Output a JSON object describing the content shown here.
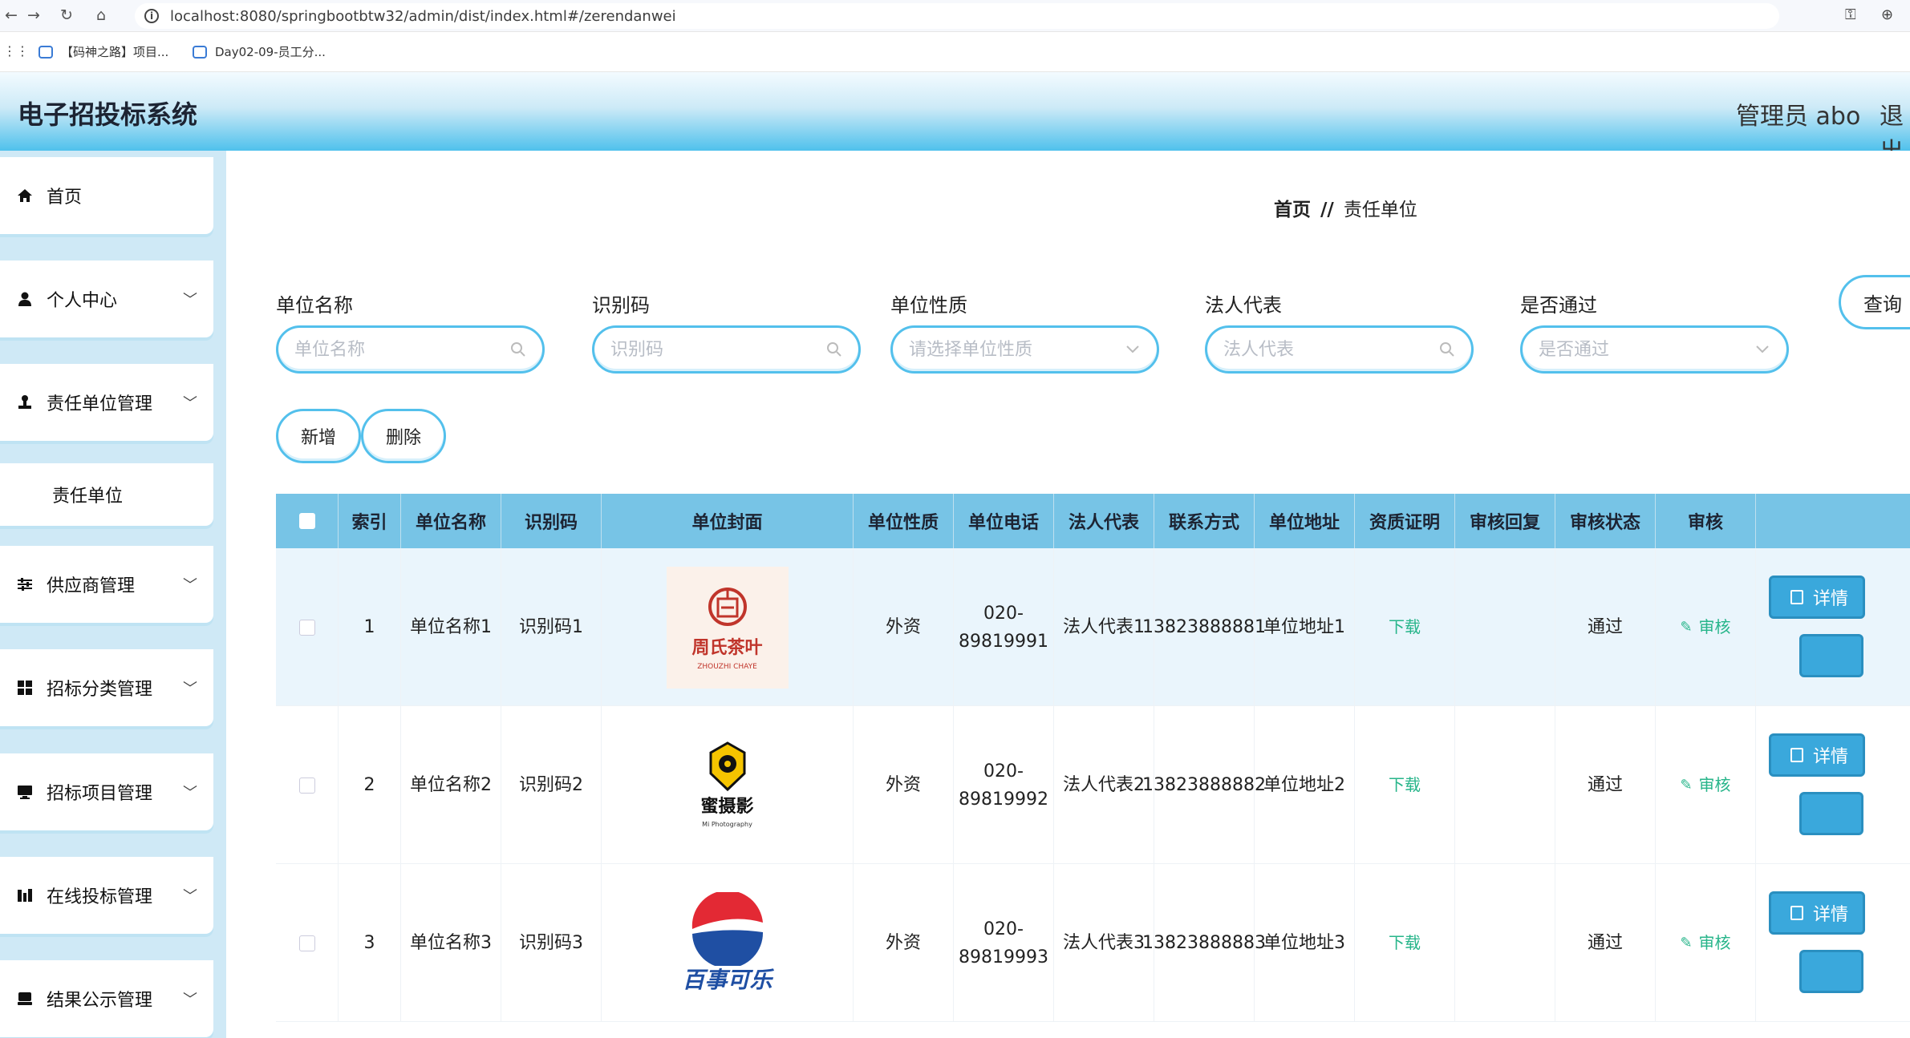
{
  "browser": {
    "url": "localhost:8080/springbootbtw32/admin/dist/index.html#/zerendanwei",
    "bookmarks": [
      "【码神之路】项目...",
      "Day02-09-员工分..."
    ]
  },
  "header": {
    "title": "电子招投标系统",
    "user": "管理员 abo",
    "logout": "退出"
  },
  "sidebar": {
    "items": [
      {
        "label": "首页",
        "icon": "home-icon"
      },
      {
        "label": "个人中心",
        "icon": "user-icon"
      },
      {
        "label": "责任单位管理",
        "icon": "stamp-icon"
      },
      {
        "label": "责任单位",
        "icon": ""
      },
      {
        "label": "供应商管理",
        "icon": "sliders-icon"
      },
      {
        "label": "招标分类管理",
        "icon": "grid-icon"
      },
      {
        "label": "招标项目管理",
        "icon": "monitor-icon"
      },
      {
        "label": "在线投标管理",
        "icon": "chart-icon"
      },
      {
        "label": "结果公示管理",
        "icon": "display-icon"
      }
    ]
  },
  "breadcrumb": {
    "home": "首页",
    "sep": "//",
    "current": "责任单位"
  },
  "search": {
    "fields": [
      {
        "label": "单位名称",
        "placeholder": "单位名称"
      },
      {
        "label": "识别码",
        "placeholder": "识别码"
      },
      {
        "label": "单位性质",
        "placeholder": "请选择单位性质"
      },
      {
        "label": "法人代表",
        "placeholder": "法人代表"
      },
      {
        "label": "是否通过",
        "placeholder": "是否通过"
      }
    ],
    "query": "查询"
  },
  "actions": {
    "add": "新增",
    "delete": "删除"
  },
  "table": {
    "headers": [
      "索引",
      "单位名称",
      "识别码",
      "单位封面",
      "单位性质",
      "单位电话",
      "法人代表",
      "联系方式",
      "单位地址",
      "资质证明",
      "审核回复",
      "审核状态",
      "审核"
    ],
    "rows": [
      {
        "index": "1",
        "name": "单位名称1",
        "code": "识别码1",
        "cover_brand": "周氏茶叶",
        "cover_sub": "ZHOUZHI CHAYE",
        "nature": "外资",
        "phone": "020-89819991",
        "legal": "法人代表1",
        "contact": "13823888881",
        "address": "单位地址1",
        "cert": "下载",
        "reply": "",
        "status": "通过",
        "audit": "审核",
        "detail": "详情"
      },
      {
        "index": "2",
        "name": "单位名称2",
        "code": "识别码2",
        "cover_brand": "蜜摄影",
        "cover_sub": "Mi Photography",
        "nature": "外资",
        "phone": "020-89819992",
        "legal": "法人代表2",
        "contact": "13823888882",
        "address": "单位地址2",
        "cert": "下载",
        "reply": "",
        "status": "通过",
        "audit": "审核",
        "detail": "详情"
      },
      {
        "index": "3",
        "name": "单位名称3",
        "code": "识别码3",
        "cover_brand": "百事可乐",
        "cover_sub": "",
        "nature": "外资",
        "phone": "020-89819993",
        "legal": "法人代表3",
        "contact": "13823888883",
        "address": "单位地址3",
        "cert": "下载",
        "reply": "",
        "status": "通过",
        "audit": "审核",
        "detail": "详情"
      }
    ]
  },
  "colors": {
    "accent": "#53c0ec",
    "header_row": "#77c4e6",
    "link": "#27b58a",
    "button": "#3aa8dc"
  }
}
